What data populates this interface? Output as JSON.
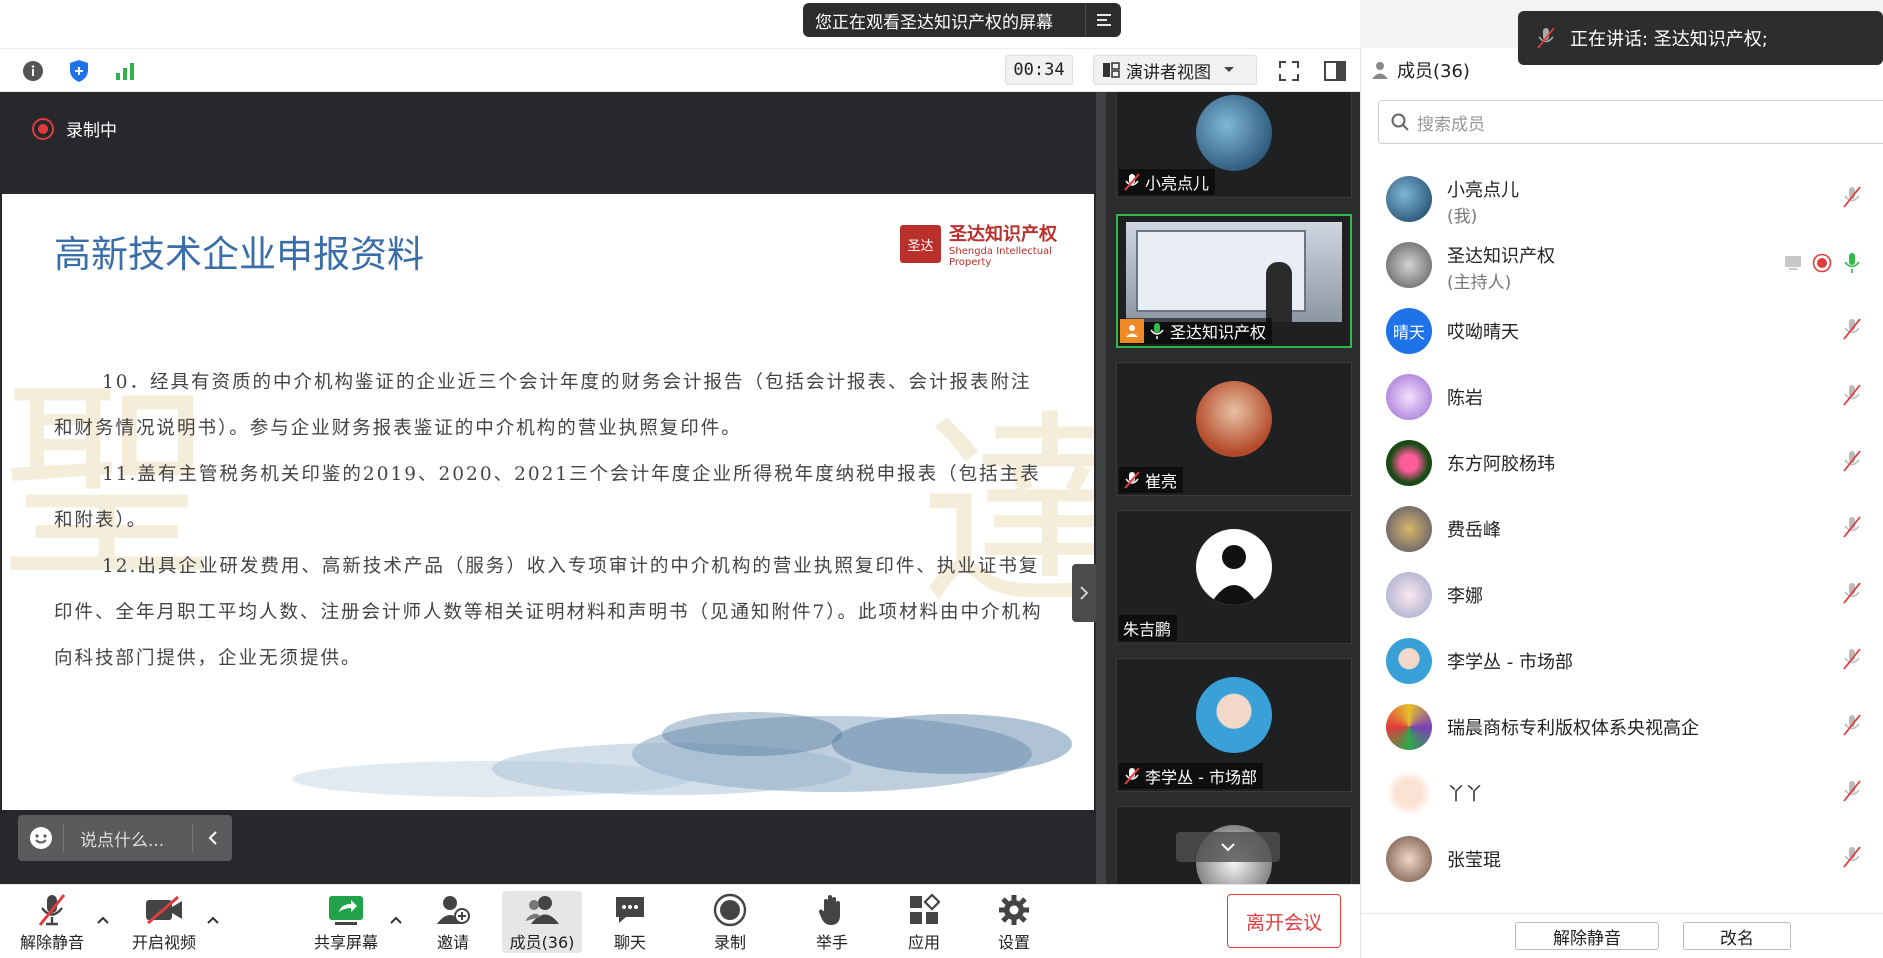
{
  "banner": {
    "text": "您正在观看圣达知识产权的屏幕"
  },
  "toolbar": {
    "timer": "00:34",
    "view_mode": "演讲者视图"
  },
  "members_header": {
    "title": "成员(36)"
  },
  "speaking": {
    "text": "正在讲话: 圣达知识产权;"
  },
  "stage": {
    "recording_label": "录制中"
  },
  "slide": {
    "title": "高新技术企业申报资料",
    "logo_seal": "圣达",
    "logo_name": "圣达知识产权",
    "logo_sub": "Shengda Intellectual Property",
    "paragraphs": [
      "10．经具有资质的中介机构鉴证的企业近三个会计年度的财务会计报告（包括会计报表、会计报表附注和财务情况说明书）。参与企业财务报表鉴证的中介机构的营业执照复印件。",
      "11.盖有主管税务机关印鉴的2019、2020、2021三个会计年度企业所得税年度纳税申报表（包括主表和附表）。",
      "12.出具企业研发费用、高新技术产品（服务）收入专项审计的中介机构的营业执照复印件、执业证书复印件、全年月职工平均人数、注册会计师人数等相关证明材料和声明书（见通知附件7）。此项材料由中介机构向科技部门提供，企业无须提供。"
    ]
  },
  "chat": {
    "placeholder": "说点什么..."
  },
  "gallery": [
    {
      "name": "小亮点儿",
      "muted": true
    },
    {
      "name": "圣达知识产权",
      "muted": false
    },
    {
      "name": "崔亮",
      "muted": true
    },
    {
      "name": "朱吉鹏",
      "muted": false
    },
    {
      "name": "李学丛 - 市场部",
      "muted": true
    }
  ],
  "bottombar": {
    "unmute": "解除静音",
    "video": "开启视频",
    "share": "共享屏幕",
    "invite": "邀请",
    "members": "成员(36)",
    "chat": "聊天",
    "record": "录制",
    "raise": "举手",
    "apps": "应用",
    "settings": "设置",
    "leave": "离开会议"
  },
  "search": {
    "placeholder": "搜索成员"
  },
  "members": [
    {
      "name": "小亮点儿",
      "sub": "(我)"
    },
    {
      "name": "圣达知识产权",
      "sub": "(主持人)"
    },
    {
      "name": "哎呦晴天",
      "avatar_text": "晴天"
    },
    {
      "name": "陈岩"
    },
    {
      "name": "东方阿胶杨玮"
    },
    {
      "name": "费岳峰"
    },
    {
      "name": "李娜"
    },
    {
      "name": "李学丛 - 市场部"
    },
    {
      "name": "瑞晨商标专利版权体系央视高企"
    },
    {
      "name": "丫丫"
    },
    {
      "name": "张莹琨"
    }
  ],
  "panel_footer": {
    "unmute_all": "解除静音",
    "rename": "改名"
  },
  "colors": {
    "accent_green": "#33b74b",
    "danger_red": "#e03e3e",
    "title_blue": "#3a6ea8",
    "brand_red": "#b9302d"
  }
}
